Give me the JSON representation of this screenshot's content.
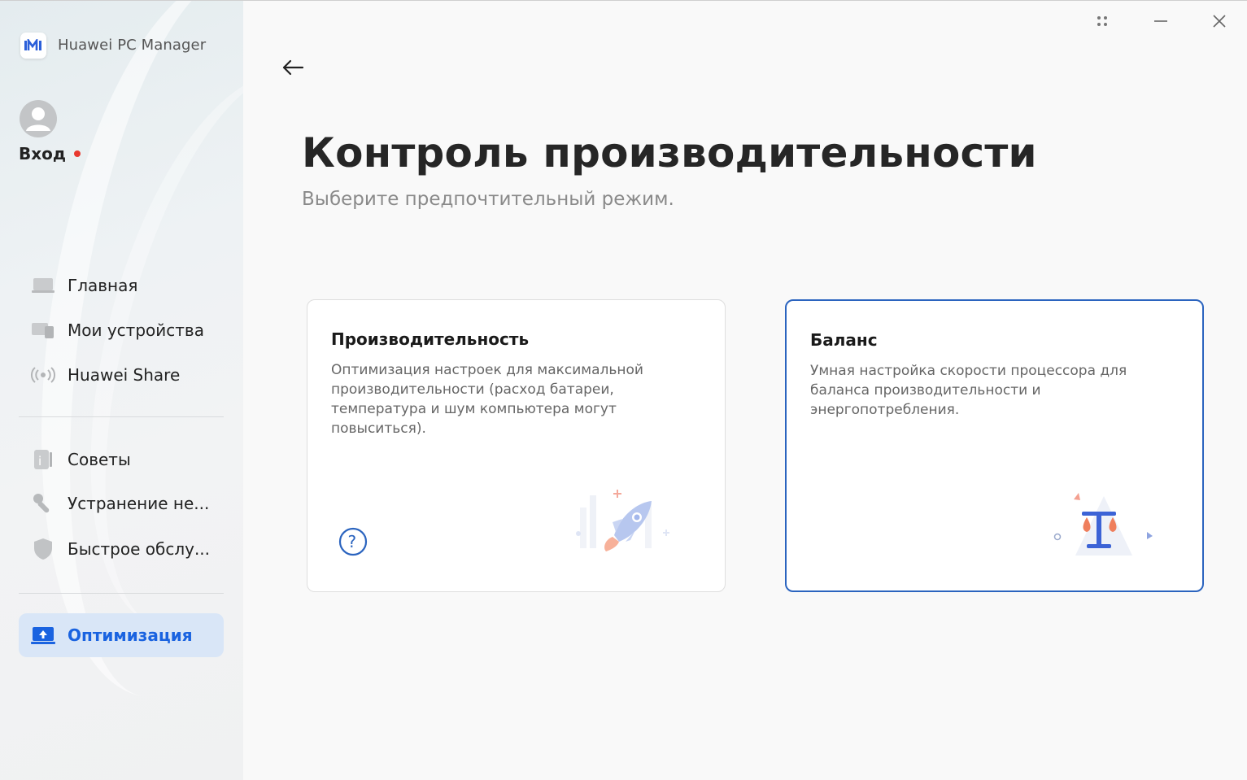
{
  "app": {
    "title": "Huawei PC Manager"
  },
  "user": {
    "login_label": "Вход"
  },
  "nav": {
    "items": [
      {
        "label": "Главная",
        "icon": "laptop-icon"
      },
      {
        "label": "Мои устройства",
        "icon": "devices-icon"
      },
      {
        "label": "Huawei Share",
        "icon": "share-wave-icon"
      },
      {
        "label": "Советы",
        "icon": "tips-icon"
      },
      {
        "label": "Устранение не...",
        "icon": "wrench-icon"
      },
      {
        "label": "Быстрое обслу...",
        "icon": "shield-icon"
      },
      {
        "label": "Оптимизация",
        "icon": "optimize-icon",
        "active": true
      }
    ]
  },
  "main": {
    "title": "Контроль производительности",
    "subtitle": "Выберите предпочтительный режим.",
    "cards": [
      {
        "title": "Производительность",
        "description": "Оптимизация настроек для максимальной производительности (расход батареи, температура и шум компьютера могут повыситься).",
        "icon": "rocket-icon",
        "selected": false
      },
      {
        "title": "Баланс",
        "description": "Умная настройка скорости процессора для баланса производительности и энергопотребления.",
        "icon": "balance-scale-icon",
        "selected": true
      }
    ]
  },
  "colors": {
    "accent": "#1a63e0",
    "selected_border": "#2b64bf",
    "badge_red": "#e8392f",
    "active_bg": "#d9e6f7"
  }
}
